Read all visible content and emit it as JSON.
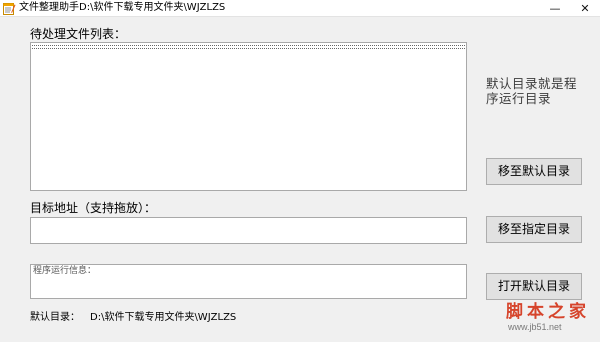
{
  "window": {
    "title": "文件整理助手D:\\软件下载专用文件夹\\WJZLZS",
    "minimize_glyph": "—",
    "close_glyph": "✕"
  },
  "list_section": {
    "label": "待处理文件列表："
  },
  "target_section": {
    "label": "目标地址（支持拖放）：",
    "value": ""
  },
  "info_section": {
    "label": "程序运行信息："
  },
  "hint_text": "默认目录就是程序运行目录",
  "buttons": {
    "move_default": "移至默认目录",
    "move_specified": "移至指定目录",
    "open_default": "打开默认目录"
  },
  "footer": {
    "default_dir_label": "默认目录：",
    "default_dir_value": "D:\\软件下载专用文件夹\\WJZLZS"
  },
  "watermark": {
    "main": "脚本之家",
    "sub": "www.jb51.net"
  },
  "icons": {
    "app": "notepad-pencil-icon",
    "minimize": "minimize-icon",
    "close": "close-icon"
  }
}
